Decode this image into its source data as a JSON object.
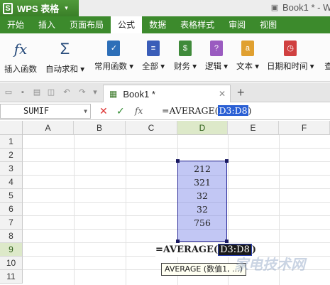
{
  "app": {
    "name": "WPS 表格",
    "logo": "S",
    "title": "Book1 * - W"
  },
  "menu": [
    "开始",
    "插入",
    "页面布局",
    "公式",
    "数据",
    "表格样式",
    "审阅",
    "视图"
  ],
  "menu_active": "公式",
  "ribbon": [
    {
      "label": "插入函数",
      "icon": "fx-icon"
    },
    {
      "label": "自动求和 ▾",
      "icon": "sigma-icon"
    },
    {
      "label": "常用函数 ▾",
      "icon": "common-functions-icon",
      "color": "#2d6fb8"
    },
    {
      "label": "全部 ▾",
      "icon": "all-functions-icon",
      "color": "#3a5db8"
    },
    {
      "label": "财务 ▾",
      "icon": "finance-icon",
      "color": "#3f8a3a",
      "glyph": "$"
    },
    {
      "label": "逻辑 ▾",
      "icon": "logic-icon",
      "color": "#9a5bc0",
      "glyph": "?"
    },
    {
      "label": "文本 ▾",
      "icon": "text-icon",
      "color": "#e0a030",
      "glyph": "a"
    },
    {
      "label": "日期和时间 ▾",
      "icon": "datetime-icon",
      "color": "#d04040"
    },
    {
      "label": "查",
      "icon": "lookup-icon",
      "color": "#666"
    }
  ],
  "doc_tab": {
    "label": "Book1 *"
  },
  "formula_bar": {
    "name_box": "SUMIF",
    "formula_prefix": "=AVERAGE(",
    "formula_ref": "D3:D8",
    "formula_suffix": ")"
  },
  "grid": {
    "columns": [
      "A",
      "B",
      "C",
      "D",
      "E",
      "F"
    ],
    "rows": [
      "1",
      "2",
      "3",
      "4",
      "5",
      "6",
      "7",
      "8",
      "9",
      "10",
      "11"
    ],
    "values_d": [
      "212",
      "321",
      "32",
      "32",
      "756"
    ],
    "edit_cell": {
      "prefix": "=AVERAGE(",
      "ref": "D3:D8",
      "suffix": ")"
    },
    "tooltip": "AVERAGE (数值1, ...)"
  },
  "watermark": "家电技术网"
}
